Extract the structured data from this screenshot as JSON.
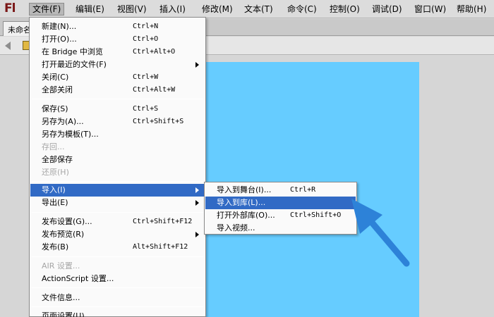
{
  "app": {
    "logo": "Fl"
  },
  "menubar": {
    "items": [
      {
        "label": "文件(F)"
      },
      {
        "label": "编辑(E)"
      },
      {
        "label": "视图(V)"
      },
      {
        "label": "插入(I)"
      },
      {
        "label": "修改(M)"
      },
      {
        "label": "文本(T)"
      },
      {
        "label": "命令(C)"
      },
      {
        "label": "控制(O)"
      },
      {
        "label": "调试(D)"
      },
      {
        "label": "窗口(W)"
      },
      {
        "label": "帮助(H)"
      }
    ]
  },
  "document": {
    "tab_label": "未命名"
  },
  "file_menu": {
    "items": [
      {
        "label": "新建(N)...",
        "shortcut": "Ctrl+N"
      },
      {
        "label": "打开(O)...",
        "shortcut": "Ctrl+O"
      },
      {
        "label": "在 Bridge 中浏览",
        "shortcut": "Ctrl+Alt+O"
      },
      {
        "label": "打开最近的文件(F)",
        "shortcut": ""
      },
      {
        "label": "关闭(C)",
        "shortcut": "Ctrl+W"
      },
      {
        "label": "全部关闭",
        "shortcut": "Ctrl+Alt+W"
      },
      {
        "label": "保存(S)",
        "shortcut": "Ctrl+S"
      },
      {
        "label": "另存为(A)...",
        "shortcut": "Ctrl+Shift+S"
      },
      {
        "label": "另存为模板(T)...",
        "shortcut": ""
      },
      {
        "label": "存回...",
        "shortcut": ""
      },
      {
        "label": "全部保存",
        "shortcut": ""
      },
      {
        "label": "还原(H)",
        "shortcut": ""
      },
      {
        "label": "导入(I)",
        "shortcut": ""
      },
      {
        "label": "导出(E)",
        "shortcut": ""
      },
      {
        "label": "发布设置(G)...",
        "shortcut": "Ctrl+Shift+F12"
      },
      {
        "label": "发布预览(R)",
        "shortcut": ""
      },
      {
        "label": "发布(B)",
        "shortcut": "Alt+Shift+F12"
      },
      {
        "label": "AIR 设置...",
        "shortcut": ""
      },
      {
        "label": "ActionScript 设置...",
        "shortcut": ""
      },
      {
        "label": "文件信息...",
        "shortcut": ""
      },
      {
        "label": "页面设置(U)...",
        "shortcut": ""
      }
    ]
  },
  "import_submenu": {
    "items": [
      {
        "label": "导入到舞台(I)...",
        "shortcut": "Ctrl+R"
      },
      {
        "label": "导入到库(L)...",
        "shortcut": ""
      },
      {
        "label": "打开外部库(O)...",
        "shortcut": "Ctrl+Shift+O"
      },
      {
        "label": "导入视频...",
        "shortcut": ""
      }
    ]
  },
  "colors": {
    "highlight": "#316ac5",
    "stage": "#66ccff",
    "annotation_arrow": "#2d82d8"
  }
}
